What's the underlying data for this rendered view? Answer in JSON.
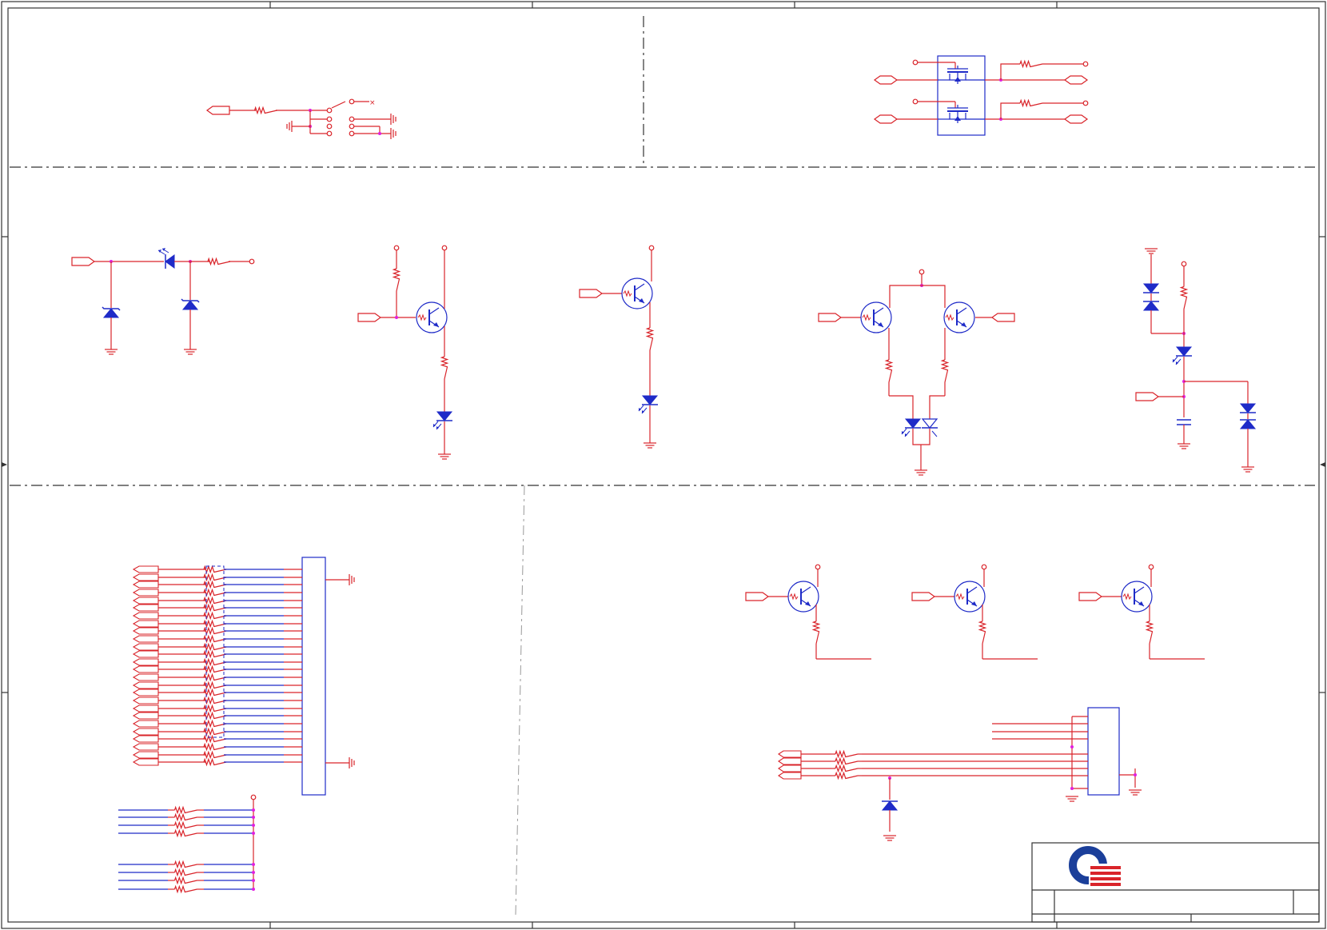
{
  "colors": {
    "wire": "#d9242a",
    "part": "#1f2bc8",
    "junction": "#e020e0",
    "frame": "#333333",
    "logo_blue": "#1b3f9a",
    "logo_red": "#d9242a"
  },
  "icons": [
    "logo-icon",
    "ground-icon",
    "led-icon",
    "zener-diode-icon",
    "transistor-icon",
    "resistor-icon",
    "mosfet-icon",
    "connector-icon",
    "capacitor-icon",
    "power-pin-icon"
  ]
}
